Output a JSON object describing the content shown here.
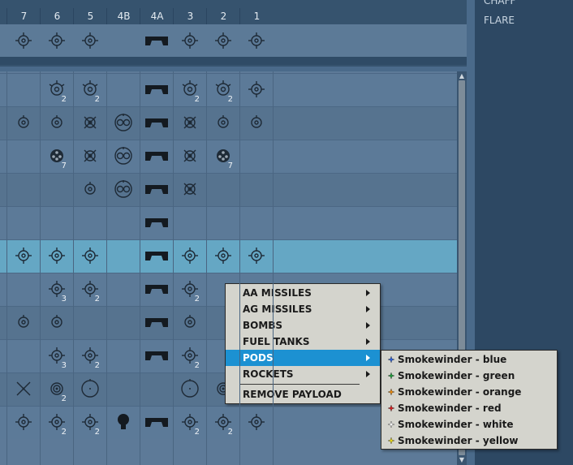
{
  "right_panel": {
    "items": [
      "CHAFF",
      "FLARE"
    ]
  },
  "columns": [
    "7",
    "6",
    "5",
    "4B",
    "4A",
    "3",
    "2",
    "1"
  ],
  "rows": [
    {
      "type": "top",
      "cells": [
        "mis",
        "mis",
        "mis",
        "",
        "tank",
        "mis",
        "mis",
        "mis"
      ]
    },
    {
      "type": "norm",
      "cells": [
        "",
        "mis2",
        "mis2",
        "",
        "tank",
        "mis2",
        "mis2",
        "mis"
      ],
      "counts": [
        "",
        "2",
        "2",
        "",
        "",
        "2",
        "2",
        ""
      ]
    },
    {
      "type": "norm",
      "cells": [
        "tgt",
        "tgt",
        "xtgt",
        "pod",
        "tank",
        "xtgt",
        "tgt",
        "tgt"
      ]
    },
    {
      "type": "norm",
      "cells": [
        "",
        "rkt",
        "xtgt",
        "pod",
        "tank",
        "xtgt",
        "rkt",
        ""
      ],
      "counts": [
        "",
        "7",
        "",
        "",
        "",
        "",
        "7",
        ""
      ]
    },
    {
      "type": "norm",
      "cells": [
        "",
        "",
        "tgt",
        "pod",
        "tank",
        "xtgt",
        "",
        ""
      ]
    },
    {
      "type": "norm",
      "cells": [
        "",
        "",
        "",
        "",
        "tank",
        "",
        "",
        ""
      ]
    },
    {
      "type": "hl",
      "cells": [
        "mis",
        "mis",
        "mis",
        "",
        "tank",
        "mis",
        "mis",
        "mis"
      ]
    },
    {
      "type": "norm",
      "cells": [
        "",
        "mis",
        "mis",
        "",
        "tank",
        "mis",
        "",
        ""
      ],
      "counts": [
        "",
        "3",
        "2",
        "",
        "",
        "2",
        "",
        ""
      ]
    },
    {
      "type": "norm",
      "cells": [
        "tgt",
        "tgt",
        "",
        "",
        "tank",
        "tgt",
        "",
        ""
      ]
    },
    {
      "type": "norm",
      "cells": [
        "",
        "mis",
        "mis",
        "",
        "tank",
        "mis",
        "",
        ""
      ],
      "counts": [
        "",
        "3",
        "2",
        "",
        "",
        "2",
        "",
        ""
      ]
    },
    {
      "type": "norm",
      "cells": [
        "cross",
        "ring",
        "circ",
        "",
        "",
        "circ",
        "ring",
        "xs"
      ],
      "counts": [
        "",
        "2",
        "",
        "",
        "",
        "",
        "2",
        ""
      ]
    },
    {
      "type": "norm",
      "cells": [
        "mis",
        "mis",
        "mis",
        "bulb",
        "tank",
        "mis",
        "mis",
        "mis"
      ],
      "counts": [
        "",
        "2",
        "2",
        "",
        "",
        "2",
        "2",
        ""
      ]
    }
  ],
  "context_menu": {
    "items": [
      {
        "label": "AA MISSILES",
        "submenu": true
      },
      {
        "label": "AG MISSILES",
        "submenu": true
      },
      {
        "label": "BOMBS",
        "submenu": true
      },
      {
        "label": "FUEL TANKS",
        "submenu": true
      },
      {
        "label": "PODS",
        "submenu": true,
        "active": true
      },
      {
        "label": "ROCKETS",
        "submenu": true
      }
    ],
    "remove_label": "REMOVE PAYLOAD"
  },
  "submenu": {
    "items": [
      {
        "label": "Smokewinder - blue",
        "color": "#2b5fd6"
      },
      {
        "label": "Smokewinder - green",
        "color": "#1e9a3a"
      },
      {
        "label": "Smokewinder - orange",
        "color": "#e88a10"
      },
      {
        "label": "Smokewinder - red",
        "color": "#d32020"
      },
      {
        "label": "Smokewinder - white",
        "color": "#f4f4f4"
      },
      {
        "label": "Smokewinder - yellow",
        "color": "#e8d81c"
      }
    ]
  }
}
